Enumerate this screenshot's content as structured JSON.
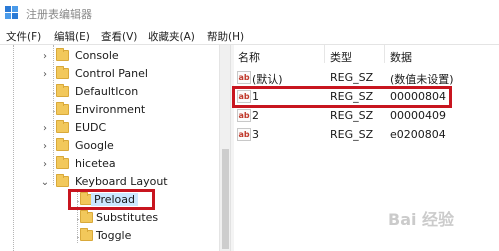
{
  "window": {
    "title": "注册表编辑器"
  },
  "menu": [
    "文件(F)",
    "编辑(E)",
    "查看(V)",
    "收藏夹(A)",
    "帮助(H)"
  ],
  "tree": {
    "items": [
      {
        "label": "Console",
        "expanded": false
      },
      {
        "label": "Control Panel",
        "expanded": false
      },
      {
        "label": "DefaultIcon",
        "expanded": false
      },
      {
        "label": "Environment",
        "expanded": false
      },
      {
        "label": "EUDC",
        "expanded": false
      },
      {
        "label": "Google",
        "expanded": false
      },
      {
        "label": "hicetea",
        "expanded": false
      },
      {
        "label": "Keyboard Layout",
        "expanded": true
      },
      {
        "label": "Preload",
        "selected": true
      },
      {
        "label": "Substitutes"
      },
      {
        "label": "Toggle"
      }
    ]
  },
  "values_pane": {
    "columns": {
      "name": "名称",
      "type": "类型",
      "data": "数据"
    },
    "rows": [
      {
        "name": "(默认)",
        "type": "REG_SZ",
        "data": "(数值未设置)"
      },
      {
        "name": "1",
        "type": "REG_SZ",
        "data": "00000804",
        "highlighted": true
      },
      {
        "name": "2",
        "type": "REG_SZ",
        "data": "00000409"
      },
      {
        "name": "3",
        "type": "REG_SZ",
        "data": "e0200804"
      }
    ]
  },
  "icons": {
    "value_icon": "ab",
    "arrow_collapsed": "›",
    "arrow_expanded": "⌄"
  },
  "colors": {
    "highlight_border": "#c8151f",
    "folder": "#f2c85b",
    "selected_item": "#cce8ff"
  },
  "watermark": "Bai 经验"
}
